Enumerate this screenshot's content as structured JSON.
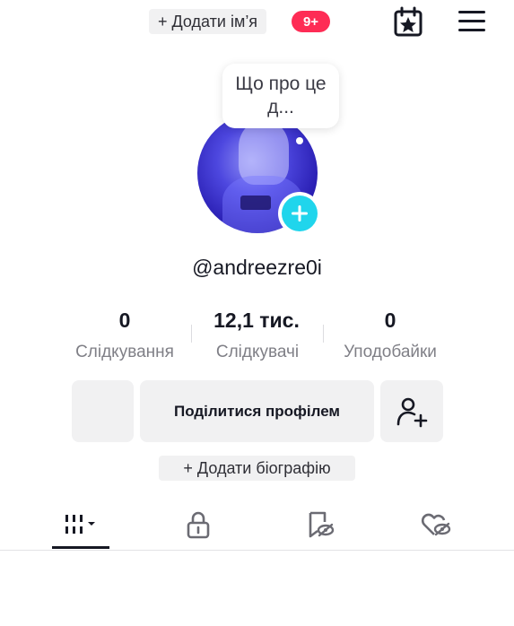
{
  "header": {
    "add_name_label": "+ Додати ім’я",
    "notification_badge": "9+",
    "calendar_icon": "calendar-star-icon",
    "menu_icon": "hamburger-menu-icon"
  },
  "bubble": {
    "text": "Що про це д..."
  },
  "profile": {
    "username": "@andreezre0i"
  },
  "stats": [
    {
      "value": "0",
      "label": "Слідкування"
    },
    {
      "value": "12,1 тис.",
      "label": "Слідкувачі"
    },
    {
      "value": "0",
      "label": "Уподобайки"
    }
  ],
  "actions": {
    "share_label": "Поділитися профілем",
    "add_friend_icon": "add-person-icon"
  },
  "bio": {
    "add_label": "+ Додати біографію"
  },
  "tabs": [
    {
      "icon": "grid-icon",
      "active": true
    },
    {
      "icon": "lock-icon",
      "active": false
    },
    {
      "icon": "bookmark-eye-icon",
      "active": false
    },
    {
      "icon": "heart-eye-icon",
      "active": false
    }
  ],
  "colors": {
    "accent_badge": "#fe2c55",
    "plus_button": "#20d5ec",
    "button_gray": "#f1f1f2",
    "text_primary": "#161823",
    "text_secondary": "#7f7f86"
  }
}
